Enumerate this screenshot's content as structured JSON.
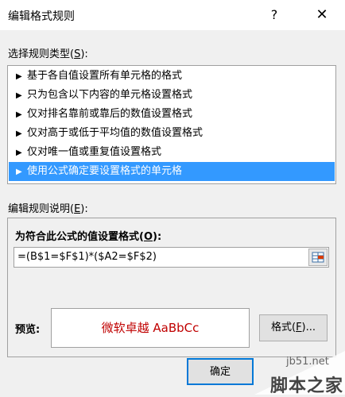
{
  "window": {
    "title": "编辑格式规则",
    "help": "?",
    "close": "✕"
  },
  "rule_type": {
    "label_prefix": "选择规则类型(",
    "label_key": "S",
    "label_suffix": "):",
    "items": [
      {
        "label": "基于各自值设置所有单元格的格式",
        "selected": false
      },
      {
        "label": "只为包含以下内容的单元格设置格式",
        "selected": false
      },
      {
        "label": "仅对排名靠前或靠后的数值设置格式",
        "selected": false
      },
      {
        "label": "仅对高于或低于平均值的数值设置格式",
        "selected": false
      },
      {
        "label": "仅对唯一值或重复值设置格式",
        "selected": false
      },
      {
        "label": "使用公式确定要设置格式的单元格",
        "selected": true
      }
    ],
    "arrow": "▶"
  },
  "description": {
    "label_prefix": "编辑规则说明(",
    "label_key": "E",
    "label_suffix": "):",
    "formula_label_prefix": "为符合此公式的值设置格式(",
    "formula_label_key": "O",
    "formula_label_suffix": "):",
    "formula_value": "=(B$1=$F$1)*($A2=$F$2)",
    "preview_label": "预览:",
    "preview_text": "微软卓越  AaBbCc",
    "format_button_prefix": "格式(",
    "format_button_key": "F",
    "format_button_suffix": ")..."
  },
  "buttons": {
    "ok": "确定"
  },
  "watermark": {
    "line1": "jb51.net",
    "line2": "脚本之家"
  },
  "colors": {
    "selection": "#3399ff",
    "preview_text": "#c00000",
    "ok_border": "#0078d7"
  }
}
